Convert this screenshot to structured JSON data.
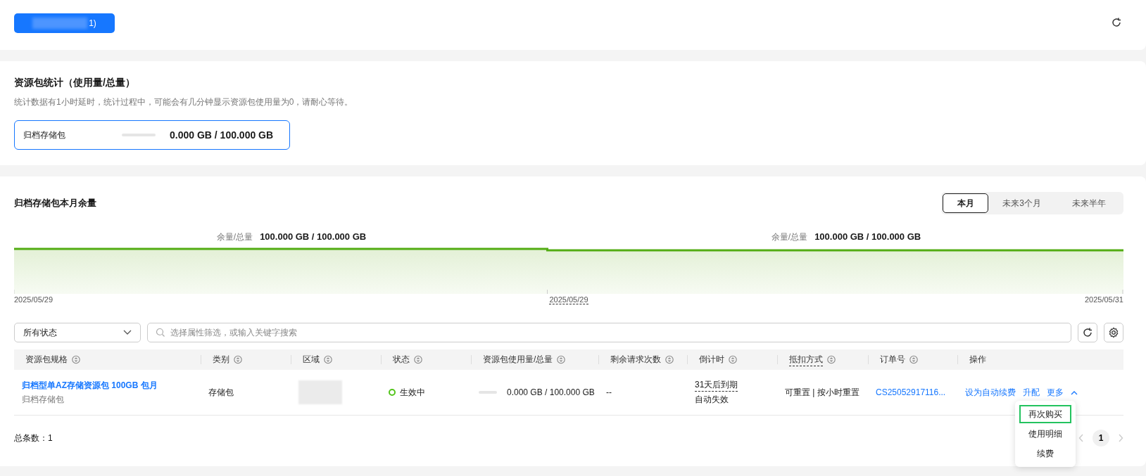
{
  "top_bar": {
    "button_label": "1)"
  },
  "stats": {
    "title": "资源包统计（使用量/总量）",
    "note": "统计数据有1小时延时，统计过程中，可能会有几分钟显示资源包使用量为0，请耐心等待。",
    "items": [
      {
        "name": "归档存储包",
        "level": 0,
        "reading": "0.000 GB / 100.000 GB"
      }
    ]
  },
  "balance": {
    "title": "归档存储包本月余量",
    "tabs": [
      {
        "label": "本月",
        "selected": true
      },
      {
        "label": "未来3个月",
        "selected": false
      },
      {
        "label": "未来半年",
        "selected": false
      }
    ],
    "segments": [
      {
        "caption": "余量/总量",
        "value": "100.000 GB / 100.000 GB"
      },
      {
        "caption": "余量/总量",
        "value": "100.000 GB / 100.000 GB"
      }
    ],
    "axis_labels": [
      {
        "text": "2025/05/29",
        "dashed": false
      },
      {
        "text": "2025/05/29",
        "dashed": true
      },
      {
        "text": "2025/05/31",
        "dashed": false
      }
    ]
  },
  "filters": {
    "status_select": "所有状态",
    "search_placeholder": "选择属性筛选，或输入关键字搜索"
  },
  "table": {
    "columns": [
      {
        "label": "资源包规格",
        "sortable": true,
        "dashed": false
      },
      {
        "label": "类别",
        "sortable": true,
        "dashed": false
      },
      {
        "label": "区域",
        "sortable": true,
        "dashed": false
      },
      {
        "label": "状态",
        "sortable": true,
        "dashed": false
      },
      {
        "label": "资源包使用量/总量",
        "sortable": true,
        "dashed": false
      },
      {
        "label": "剩余请求次数",
        "sortable": true,
        "dashed": false
      },
      {
        "label": "倒计时",
        "sortable": true,
        "dashed": false
      },
      {
        "label": "抵扣方式",
        "sortable": true,
        "dashed": true
      },
      {
        "label": "订单号",
        "sortable": true,
        "dashed": false
      },
      {
        "label": "操作",
        "sortable": false,
        "dashed": false
      }
    ],
    "rows": [
      {
        "spec": "归档型单AZ存储资源包 100GB 包月",
        "spec_sub": "归档存储包",
        "category": "存储包",
        "status": "生效中",
        "color": "#52c41a",
        "level": 0,
        "usage": "0.000 GB / 100.000 GB",
        "requests": "--",
        "countdown": "31天后到期",
        "countdown_sub": "自动失效",
        "deduction": "可重置 | 按小时重置",
        "order": "CS25052917116...",
        "actions": [
          "设为自动续费",
          "升配",
          "更多"
        ]
      }
    ]
  },
  "more_menu": [
    {
      "label": "再次购买",
      "selected": true
    },
    {
      "label": "使用明细",
      "selected": false
    },
    {
      "label": "续费",
      "selected": false
    }
  ],
  "footer": {
    "total": "总条数：1",
    "pages": [
      {
        "label": "1",
        "selected": true
      }
    ]
  }
}
